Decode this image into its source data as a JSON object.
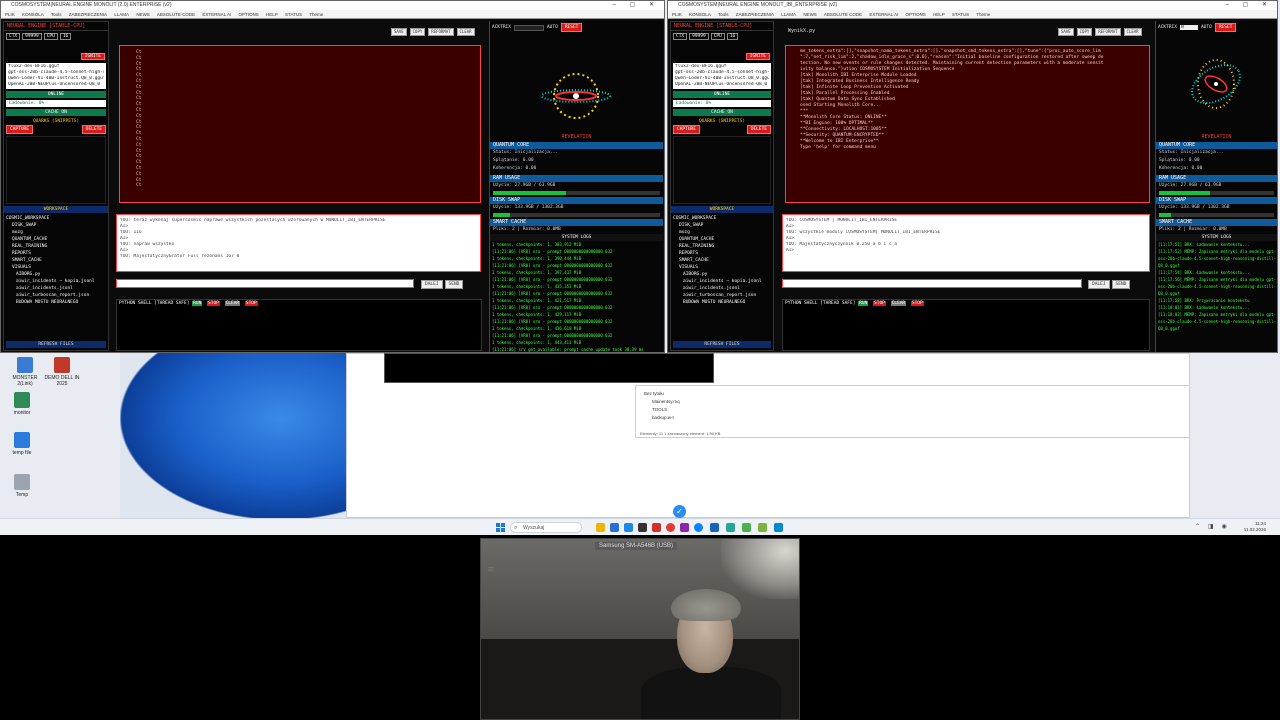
{
  "desktop": {
    "icons": [
      {
        "label": "MONSTER 2(Link)",
        "color": "#3a7bd5"
      },
      {
        "label": "DEMO DELL IN 2025",
        "color": "#c0392b"
      },
      {
        "label": "monitor",
        "color": "#2e8b57"
      },
      {
        "label": "temp file",
        "color": "#2a7ae0"
      },
      {
        "label": "Temp",
        "color": "#9aa5b1"
      }
    ]
  },
  "left_window": {
    "title": "COSMOSYSTEM|NEURAL ENGINE MONOLIT (2.0) ENTERPRISE (v2)",
    "menu": [
      "PLIK",
      "KONSOLA",
      "Tools",
      "ZABEZPIECZENIA",
      "LLAMA",
      "NEWS",
      "ABSOLUTE CODE",
      "EXTERNAL AI",
      "OPTIONS",
      "HELP",
      "STATUS",
      "Theme"
    ],
    "neural": {
      "title": "NEURAL ENGINE [STABLE-CPU]",
      "ctx_label": "CTX",
      "ctx_value": "99999",
      "cpu_label": "CPU",
      "cpu_value": "16",
      "ignite": "IGNITE",
      "models": [
        "flux2-dev-BF16.gguf",
        "gpt-oss-20b-claude-4.5-sonnet-high-rea",
        "Qwen-Coder-V1-40B-Instruct.Q8_0.gguf",
        "OpenAI-20B-NEOPlus-Uncensored-Q8_0"
      ],
      "status": "ONLINE",
      "loading": "Ładowanie: 0%",
      "cache": "CACHE ON",
      "quarks_title": "QUARKS (SNIPPETS)",
      "capture": "CAPTURE",
      "delete": "DELETE"
    },
    "workspace": {
      "title": "WORKSPACE",
      "items": [
        "COSMIC_WORKSPACE",
        "DISK_SWAP",
        "mozg",
        "QUANTUM_CACHE",
        "REAL_TRAINING",
        "REPORTS",
        "SMART_CACHE",
        "VISUALS",
        "AIBORG.py",
        "aiwir_incidents — kopia.jsonl",
        "aiwir_incidents.jsonl",
        "aiwir_turboscan_report.json",
        "BUDOWA MOSTU NEURALNEGO"
      ],
      "refresh": "REFRESH FILES"
    },
    "editor": {
      "tabs": [
        "SAVE",
        "COPY",
        "REFORMAT",
        "CLEAR"
      ],
      "lines": [
        "Ct",
        "Ct",
        "Ct",
        "Ct",
        "Ct",
        "Ct",
        "Ct",
        "Ct",
        "Ct",
        "Ct",
        "Ct",
        "Ct",
        "Ct",
        "Ct",
        "Ct",
        "Ct",
        "Ct",
        "Ct",
        "Ct",
        "Ct",
        "Ct",
        "Ct",
        "Ct",
        "Ct"
      ]
    },
    "chat": {
      "lines": [
        "YOU: teraz wykonaj supercosmic naprawe wszystkich pozostalych wzorowanych w MONOLIT_IBI_ENTERPRISE",
        "AI>",
        "YOU: 116",
        "AI>",
        "YOU: napraw wszystko",
        "AI>",
        "YOU: Majestatyczny&rator Full rezonans 167 0"
      ],
      "dalej": "DALEJ",
      "send": "SEND"
    },
    "shell": {
      "title": "PYTHON SHELL [THREAD SAFE]",
      "btns": [
        "RUN",
        "STOP",
        "CLEAR",
        "STOP"
      ]
    }
  },
  "left_monitor": {
    "head": [
      "ACKTRIX",
      "AUTO",
      "RESET"
    ],
    "revelation": "REVELATION",
    "qcore": {
      "title": "QUANTUM CORE",
      "status": "Status: Inicjalizacja...",
      "splatanie": "Splątanie: 0.00",
      "koherencja": "Koherencja: 0.00"
    },
    "ram": {
      "title": "RAM USAGE",
      "text": "Użycie: 27.9GB / 63.9GB",
      "fraction": 0.44
    },
    "swap": {
      "title": "DISK SWAP",
      "text": "Użycie: 133.9GB / 1302.3GB",
      "fraction": 0.1
    },
    "smart": {
      "title": "SMART CACHE",
      "text": "Pliki: 2 | Rozmiar: 0.0MB"
    },
    "syslog_title": "SYSTEM LOGS",
    "syslog": [
      "1 tokens, checkpoints: 1, 383,912 MiB",
      "[11:21:06] [VR0] ora - prompt 0000000000000000 032",
      "1 tokens, checkpoints: 1, 390,444 MiB",
      "[11:21:06] [VR0] ora - prompt 0000000000000000 032",
      "1 tokens, checkpoints: 1, 397,437 MiB",
      "[11:21:06] [VR0] ora - prompt 0000000000000000 032",
      "1 tokens, checkpoints: 1, 435,353 MiB",
      "[11:21:06] [VR0] ora - prompt 0000000000000000 032",
      "1 tokens, checkpoints: 1, 421,517 MiB",
      "[11:21:06] [VR0] ora - prompt 0000000000000000 032",
      "1 tokens, checkpoints: 1, 429,117 MiB",
      "[11:21:06] [VR0] ora - prompt 0000000000000000 032",
      "1 tokens, checkpoints: 1, 436,618 MiB",
      "[11:21:06] [VR0] ora - prompt 0000000000000000 032",
      "1 tokens, checkpoints: 1, 443,411 MiB",
      "[11:21:06] srv get_available: prompt cache update took 30,39 ms"
    ]
  },
  "right_window": {
    "title": "COSMOSYSTEM|NEURAL ENGINE MONOLIT_IBI_ENTERPRISE (v2)",
    "menu": [
      "PLIK",
      "KONSOLA",
      "Tools",
      "ZABEZPIECZENIA",
      "LLAMA",
      "NEWS",
      "ABSOLUTE CODE",
      "EXTERNAL AI",
      "OPTIONS",
      "HELP",
      "STATUS",
      "Theme"
    ],
    "neural": {
      "title": "NEURAL ENGINE [STABLE-CPU]",
      "ctx_label": "CTX",
      "ctx_value": "99999",
      "cpu_label": "CPU",
      "cpu_value": "16",
      "ignite": "IGNITE",
      "models": [
        "flux2-dev-BF16.gguf",
        "gpt-oss-20b-claude-4.5-sonnet-high-rea",
        "Qwen-Coder-V1-40B-Instruct.Q8_0.gguf",
        "OpenAI-20B-NEOPlus-Uncensored-Q8_0"
      ],
      "status": "ONLINE",
      "loading": "Ładowanie: 0%",
      "cache": "CACHE ON",
      "quarks_title": "QUARKS (SNIPPETS)",
      "capture": "CAPTURE",
      "delete": "DELETE"
    },
    "workspace": {
      "title": "WORKSPACE",
      "items": [
        "COSMIC_WORKSPACE",
        "DISK_SWAP",
        "mozg",
        "QUANTUM_CACHE",
        "REAL_TRAINING",
        "REPORTS",
        "SMART_CACHE",
        "VISUALS",
        "AIBORG.py",
        "aiwir_incidents — kopia.jsonl",
        "aiwir_incidents.jsonl",
        "aiwir_turboscan_report.json",
        "BUDOWA MOSTU NEURALNEGO"
      ],
      "refresh": "REFRESH FILES"
    },
    "editor": {
      "filename": "WynikX.py",
      "tabs": [
        "SAVE",
        "COPY",
        "REFORMAT",
        "CLEAR"
      ],
      "lines": [
        "me_tokens_extra\":[],\"snapshot_name_tokens_extra\":[],\"snapshot_cmd_tokens_extra\":[],\"tune\":{\"proc_auto_score_lim",
        "\":7,\"net_risk_lim\":2,\"shadow_idle_grace_s\":0.0},\"reason\":\"Initial baseline configuration restored after sweep de",
        "tection. No new events or rule changes detected. Maintaining current detection parameters with a moderate sensit",
        "ivity balance.\"}ution COSMOSYSTEM Initialization Sequence",
        "",
        "[tak] Monolith IBI Enterprise Module Loaded",
        "[tak] Integrated Business Intelligence Ready",
        "[tak] Infinite Loop Prevention Activated",
        "[tak] Parallel Processing Enabled",
        "[tak] Quantum Data Sync Established",
        "",
        "osed Starting Monolith Core...",
        "***",
        "",
        "**Monolith Core Status: ONLINE**",
        "**BI Engine: 100% OPTIMAL**",
        "**Connectivity: LOCALHOST:1005**",
        "**Security: QUANTUM-ENCRYPTED**",
        "",
        "**Welcome to IBI Enterprise**",
        "Type 'help' for command menu"
      ]
    },
    "chat": {
      "lines": [
        "YOU: COSMOSYSTEM | MONOLIT_IBI_ENTERPRISE",
        "AI>",
        "YOU: wszystkie moduly COSMOSYSTEM| MONOLIT_IBI_ENTERPRISE",
        "AI>",
        "YOU: Majestatycznyczynnik 0.250 a b i c a",
        "AI>"
      ],
      "dalej": "DALEJ",
      "send": "SEND"
    },
    "shell": {
      "title": "PYTHON SHELL [THREAD SAFE]",
      "btns": [
        "RUN",
        "STOP",
        "CLEAR",
        "STOP"
      ]
    }
  },
  "right_monitor": {
    "head": [
      "ACKTRIX",
      "N",
      "AUTO",
      "RESET"
    ],
    "revelation": "REVELATION",
    "qcore": {
      "title": "QUANTUM CORE",
      "status": "Status: Inicjalizacja...",
      "splatanie": "Splątanie: 0.00",
      "koherencja": "Koherencja: 0.00"
    },
    "ram": {
      "title": "RAM USAGE",
      "text": "Użycie: 27.9GB / 63.9GB",
      "fraction": 0.44
    },
    "swap": {
      "title": "DISK SWAP",
      "text": "Użycie: 133.9GB / 1302.3GB",
      "fraction": 0.1
    },
    "smart": {
      "title": "SMART CACHE",
      "text": "Pliki: 2 | Rozmiar: 0.0MB"
    },
    "syslog_title": "SYSTEM LOGS",
    "syslog": [
      "[11:17:51] BRX: Ładowanie kontekstu...",
      "[11:17:52] MEMP: Zapisano metryki dla modelu gpt-",
      "oss-20b-claude-4.5-sonnet-high-reasoning-distill-",
      "Q8_0.gguf",
      "[11:17:54] BRX: Ładowanie kontekstu...",
      "[11:17:56] MEMP: Zapisano metryki dla modelu gpt-",
      "oss-20b-claude-4.5-sonnet-high-reasoning-distill-",
      "Q8_0.gguf",
      "[11:17:58] BRX: Przywracanie kontekstu",
      "[11:18:01] BRX: Ładowanie kontekstu...",
      "[11:18:03] MEMP: Zapisano metryki dla modelu gpt-",
      "oss-20b-claude-4.5-sonnet-high-reasoning-distill-",
      "Q8_0.gguf"
    ]
  },
  "file_explorer": {
    "tree": [
      "Bez tytułu",
      "Mainentsy.mq",
      "TOOLS",
      "backup.w-t"
    ],
    "status": "Elementy: 11   1 zaznaczony element: 1,50 KB"
  },
  "taskbar": {
    "search_placeholder": "Wyszukaj",
    "time": "11:24",
    "date": "11.02.2026"
  },
  "camera": {
    "label": "Samsung SM-A546B (USB)"
  }
}
